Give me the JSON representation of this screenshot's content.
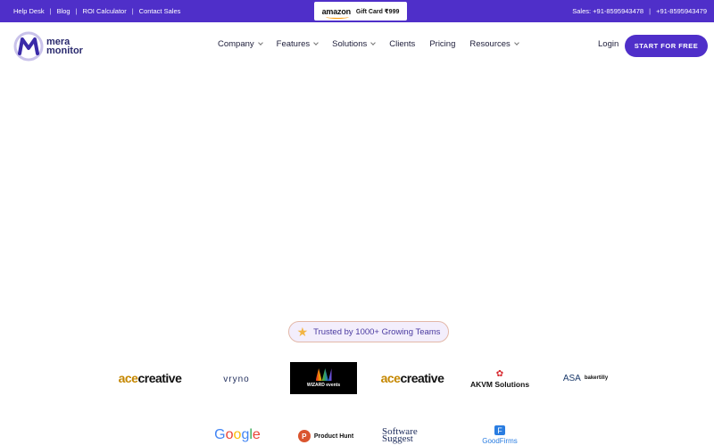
{
  "topbar": {
    "links": [
      "Help Desk",
      "Blog",
      "ROI Calculator",
      "Contact Sales"
    ],
    "separator": "|",
    "promo": {
      "brand": "amazon",
      "text": "Gift Card ₹999"
    },
    "sales_label": "Sales: +91-8595943478",
    "phone2": "+91-8595943479"
  },
  "nav": {
    "logo_line1": "mera",
    "logo_line2": "monitor",
    "menu": [
      {
        "label": "Company",
        "dropdown": true
      },
      {
        "label": "Features",
        "dropdown": true
      },
      {
        "label": "Solutions",
        "dropdown": true
      },
      {
        "label": "Clients",
        "dropdown": false
      },
      {
        "label": "Pricing",
        "dropdown": false
      },
      {
        "label": "Resources",
        "dropdown": true
      }
    ],
    "login": "Login",
    "cta": "START FOR FREE"
  },
  "trusted": {
    "text": "Trusted by 1000+ Growing Teams",
    "icon": "star-icon"
  },
  "clients": {
    "row1": [
      {
        "name": "acecreative",
        "part1": "ace",
        "part2": "creative"
      },
      {
        "name": "vryno",
        "text": "vryno"
      },
      {
        "name": "wizard-events",
        "text": "WIZARD events"
      },
      {
        "name": "acecreative",
        "part1": "ace",
        "part2": "creative"
      },
      {
        "name": "akvm",
        "text": "AKVM Solutions"
      },
      {
        "name": "asa-bakertilly",
        "text1": "ASA",
        "text2": "bakertilly"
      }
    ],
    "row2": [
      {
        "name": "google",
        "text": "Google"
      },
      {
        "name": "product-hunt",
        "text": "Product Hunt",
        "mark": "P"
      },
      {
        "name": "software-suggest",
        "text": "Software Suggest"
      },
      {
        "name": "goodfirms",
        "text": "GoodFirms",
        "mark": "F"
      }
    ]
  },
  "colors": {
    "brand": "#4f2fc9",
    "accent": "#f2b544"
  }
}
